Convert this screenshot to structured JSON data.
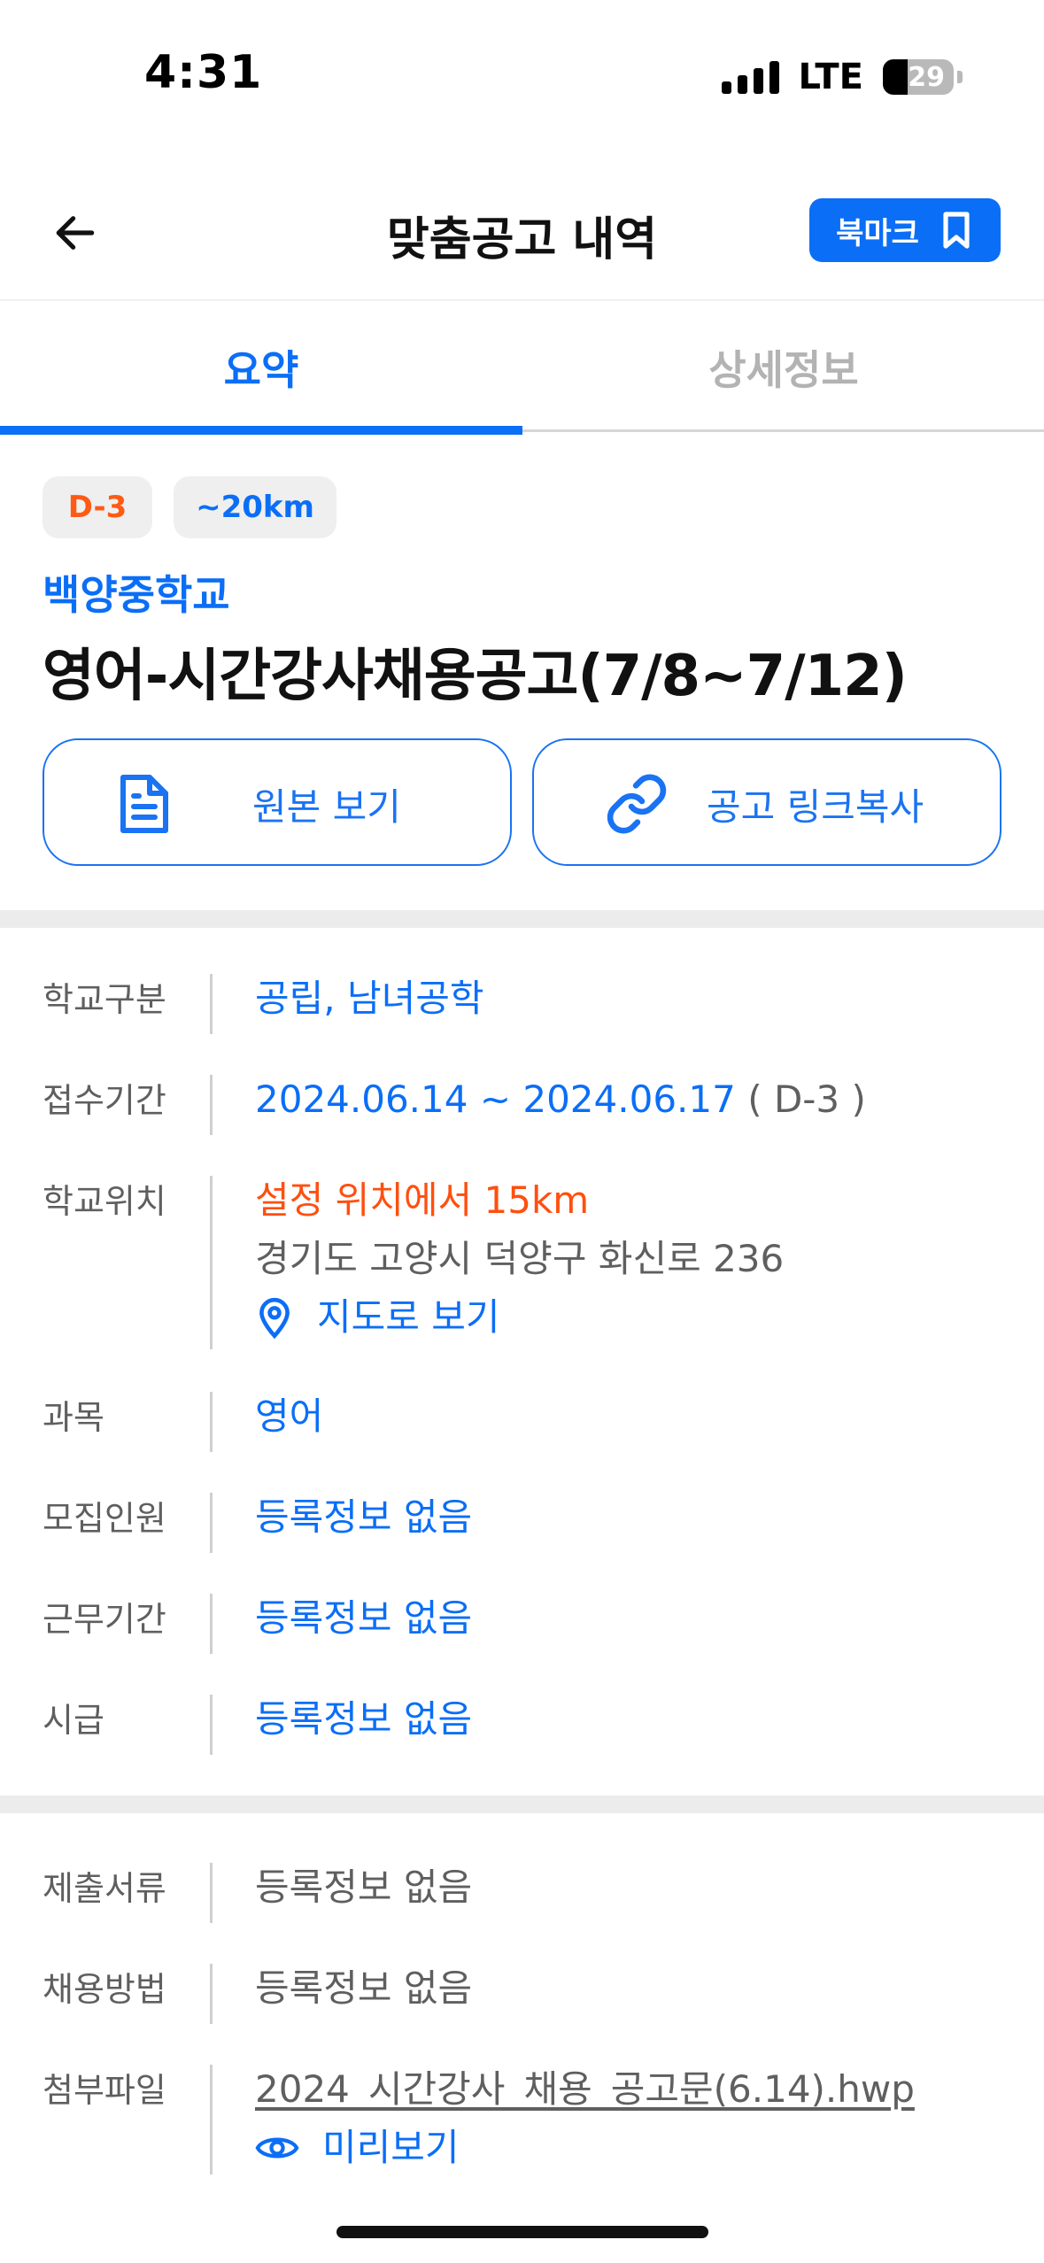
{
  "status_bar": {
    "time": "4:31",
    "network": "LTE",
    "battery": "29"
  },
  "header": {
    "title": "맞춤공고 내역",
    "bookmark_label": "북마크"
  },
  "tabs": [
    {
      "label": "요약",
      "active": true
    },
    {
      "label": "상세정보",
      "active": false
    }
  ],
  "summary": {
    "badge_dday": "D-3",
    "badge_distance": "~20km",
    "school_name": "백양중학교",
    "post_title": "영어-시간강사채용공고(7/8~7/12)",
    "view_original_label": "원본 보기",
    "copy_link_label": "공고 링크복사"
  },
  "details": {
    "school_type": {
      "label": "학교구분",
      "value": "공립, 남녀공학"
    },
    "period": {
      "label": "접수기간",
      "value": "2024.06.14 ~ 2024.06.17",
      "dday": "( D-3 )"
    },
    "location": {
      "label": "학교위치",
      "distance": "설정 위치에서 15km",
      "address": "경기도 고양시 덕양구 화신로 236",
      "map_label": "지도로 보기"
    },
    "subject": {
      "label": "과목",
      "value": "영어"
    },
    "headcount": {
      "label": "모집인원",
      "value": "등록정보 없음"
    },
    "work_period": {
      "label": "근무기간",
      "value": "등록정보 없음"
    },
    "hourly_wage": {
      "label": "시급",
      "value": "등록정보 없음"
    }
  },
  "extra": {
    "documents": {
      "label": "제출서류",
      "value": "등록정보 없음"
    },
    "hiring_method": {
      "label": "채용방법",
      "value": "등록정보 없음"
    },
    "attachment": {
      "label": "첨부파일",
      "file_name": "2024_시간강사_채용_공고문(6.14).hwp",
      "preview_label": "미리보기"
    }
  },
  "colors": {
    "accent": "#0b6ef6",
    "warning": "#ff4f0f",
    "muted": "#5f5f5f"
  }
}
